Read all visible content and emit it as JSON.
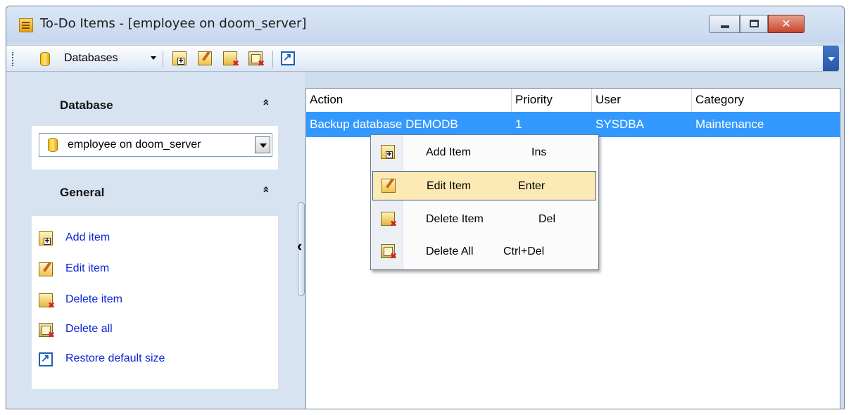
{
  "window": {
    "title": "To-Do Items - [employee on doom_server]",
    "close_glyph": "✕"
  },
  "toolbar": {
    "databases_label": "Databases",
    "buttons": [
      {
        "icon": "add-item-icon",
        "tooltip": "Add item"
      },
      {
        "icon": "edit-item-icon",
        "tooltip": "Edit item"
      },
      {
        "icon": "delete-item-icon",
        "tooltip": "Delete item"
      },
      {
        "icon": "delete-all-icon",
        "tooltip": "Delete all"
      },
      {
        "icon": "restore-size-icon",
        "tooltip": "Restore default size"
      }
    ]
  },
  "sidebar": {
    "database_panel": {
      "title": "Database",
      "collapse_glyph": "»",
      "selected_db": "employee on doom_server"
    },
    "general_panel": {
      "title": "General",
      "collapse_glyph": "»",
      "links": [
        {
          "label": "Add item",
          "icon": "add-item-icon"
        },
        {
          "label": "Edit item",
          "icon": "edit-item-icon"
        },
        {
          "label": "Delete item",
          "icon": "delete-item-icon"
        },
        {
          "label": "Delete all",
          "icon": "delete-all-icon"
        },
        {
          "label": "Restore default size",
          "icon": "restore-size-icon"
        }
      ]
    }
  },
  "grid": {
    "columns": [
      "Action",
      "Priority",
      "User",
      "Category"
    ],
    "rows": [
      {
        "action": "Backup database DEMODB",
        "priority": "1",
        "user": "SYSDBA",
        "category": "Maintenance",
        "selected": true
      }
    ]
  },
  "context_menu": {
    "items": [
      {
        "label": "Add Item",
        "shortcut": "Ins",
        "icon": "add-item-icon",
        "highlighted": false
      },
      {
        "label": "Edit Item",
        "shortcut": "Enter",
        "icon": "edit-item-icon",
        "highlighted": true
      },
      {
        "label": "Delete Item",
        "shortcut": "Del",
        "icon": "delete-item-icon",
        "highlighted": false
      },
      {
        "label": "Delete All",
        "shortcut": "Ctrl+Del",
        "icon": "delete-all-icon",
        "highlighted": false
      }
    ]
  },
  "colors": {
    "selection": "#3399ff",
    "menu_highlight": "#fde9b4",
    "link": "#0a24d6",
    "panel_background": "#d7e3f1"
  }
}
